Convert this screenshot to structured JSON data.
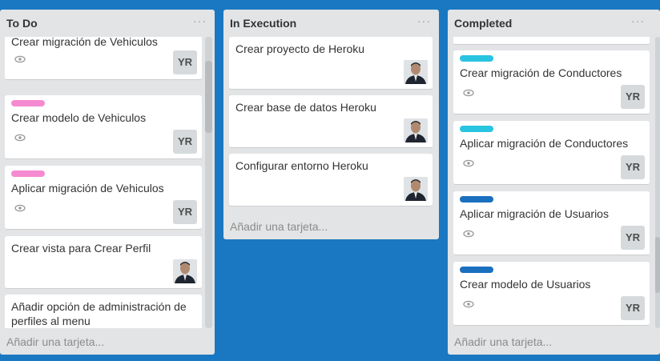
{
  "lists": [
    {
      "title": "To Do",
      "add_card": "Añadir una tarjeta...",
      "cards": [
        {
          "title": "Crear migración de Vehiculos",
          "member": "YR"
        },
        {
          "title": "Crear modelo de Vehiculos",
          "label_color": "#f58ad1",
          "member": "YR"
        },
        {
          "title": "Aplicar migración de Vehiculos",
          "label_color": "#f58ad1",
          "member": "YR"
        },
        {
          "title": "Crear vista para Crear Perfil"
        },
        {
          "title": "Añadir opción de administración de perfiles al menu"
        }
      ]
    },
    {
      "title": "In Execution",
      "add_card": "Añadir una tarjeta...",
      "cards": [
        {
          "title": "Crear proyecto de Heroku"
        },
        {
          "title": "Crear base de datos Heroku"
        },
        {
          "title": "Configurar entorno Heroku"
        }
      ]
    },
    {
      "title": "Completed",
      "add_card": "Añadir una tarjeta...",
      "cards": [
        {
          "title": "Crear migración de Conductores",
          "label_color": "#29c4e0",
          "member": "YR"
        },
        {
          "title": "Aplicar migración de Conductores",
          "label_color": "#29c4e0",
          "member": "YR"
        },
        {
          "title": "Aplicar migración de Usuarios",
          "label_color": "#1a6fbf",
          "member": "YR"
        },
        {
          "title": "Crear modelo de Usuarios",
          "label_color": "#1a6fbf",
          "member": "YR"
        }
      ]
    }
  ],
  "list_menu_icon": "···"
}
